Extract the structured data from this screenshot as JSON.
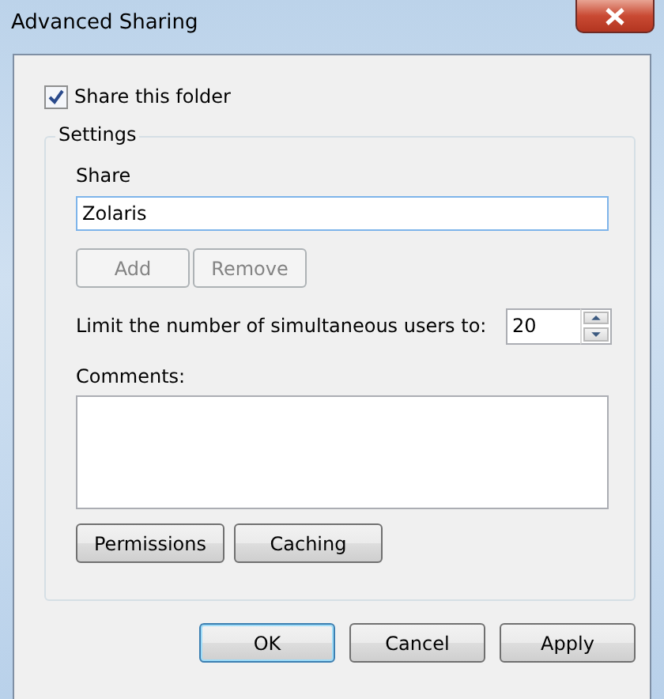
{
  "window": {
    "title": "Advanced Sharing"
  },
  "share_folder": {
    "label": "Share this folder",
    "checked": true
  },
  "settings": {
    "legend": "Settings",
    "share_label": "Share",
    "share_name": "Zolaris",
    "share_buttons": [
      {
        "label": "Add",
        "disabled": true
      },
      {
        "label": "Remove",
        "disabled": true
      }
    ],
    "limit_label": "Limit the number of simultaneous users to:",
    "limit_value": "20",
    "comments_label": "Comments:",
    "buttons": [
      {
        "label": "Permissions"
      },
      {
        "label": "Caching"
      }
    ]
  },
  "buttons": [
    {
      "label": "OK",
      "default": true
    },
    {
      "label": "Cancel",
      "default": false
    },
    {
      "label": "Apply",
      "default": false
    }
  ]
}
